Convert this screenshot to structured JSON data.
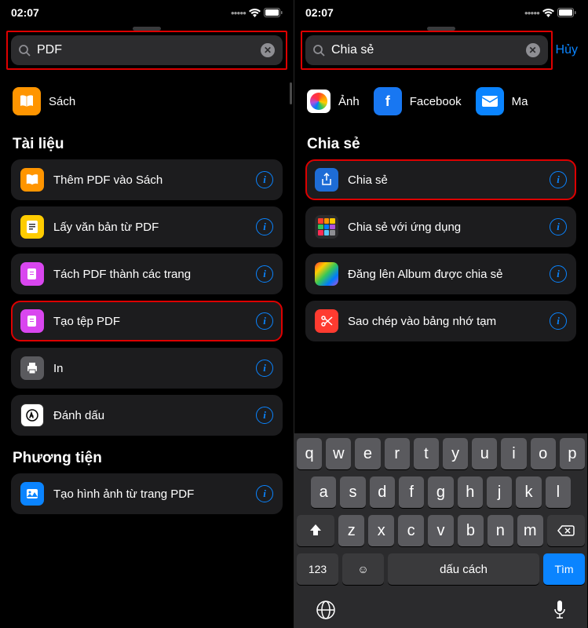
{
  "status": {
    "time": "02:07",
    "wifi": true,
    "battery": true
  },
  "left": {
    "search": {
      "value": "PDF",
      "placeholder": "Tìm kiếm"
    },
    "app_row": [
      {
        "name": "Sách",
        "icon": "book",
        "bg": "bg-orange"
      }
    ],
    "sections": [
      {
        "title": "Tài liệu",
        "items": [
          {
            "label": "Thêm PDF vào Sách",
            "icon": "book",
            "bg": "bg-orange",
            "highlight": false
          },
          {
            "label": "Lấy văn bản từ PDF",
            "icon": "text",
            "bg": "bg-yellow",
            "highlight": false
          },
          {
            "label": "Tách PDF thành các trang",
            "icon": "split",
            "bg": "bg-magenta",
            "highlight": false
          },
          {
            "label": "Tạo tệp PDF",
            "icon": "make",
            "bg": "bg-magenta",
            "highlight": true
          },
          {
            "label": "In",
            "icon": "print",
            "bg": "bg-gray",
            "highlight": false
          },
          {
            "label": "Đánh dấu",
            "icon": "markup",
            "bg": "bg-white",
            "highlight": false
          }
        ]
      },
      {
        "title": "Phương tiện",
        "items": [
          {
            "label": "Tạo hình ảnh từ trang PDF",
            "icon": "image",
            "bg": "bg-blue",
            "highlight": false
          }
        ]
      }
    ]
  },
  "right": {
    "search": {
      "value": "Chia sẻ",
      "placeholder": "Tìm kiếm"
    },
    "cancel": "Hủy",
    "app_row": [
      {
        "name": "Ảnh",
        "icon": "photos"
      },
      {
        "name": "Facebook",
        "icon": "fb"
      },
      {
        "name": "Ma",
        "icon": "mail"
      }
    ],
    "sections": [
      {
        "title": "Chia sẻ",
        "items": [
          {
            "label": "Chia sẻ",
            "icon": "share",
            "bg": "bg-darkblue",
            "highlight": true
          },
          {
            "label": "Chia sẻ với ứng dụng",
            "icon": "grid",
            "bg": "bg-grid",
            "highlight": false
          },
          {
            "label": "Đăng lên Album được chia sẻ",
            "icon": "photos-flower",
            "bg": "bg-multi",
            "highlight": false
          },
          {
            "label": "Sao chép vào bảng nhớ tạm",
            "icon": "scissors",
            "bg": "bg-red",
            "highlight": false
          }
        ]
      }
    ],
    "keyboard": {
      "row1": [
        "q",
        "w",
        "e",
        "r",
        "t",
        "y",
        "u",
        "i",
        "o",
        "p"
      ],
      "row2": [
        "a",
        "s",
        "d",
        "f",
        "g",
        "h",
        "j",
        "k",
        "l"
      ],
      "row3": [
        "z",
        "x",
        "c",
        "v",
        "b",
        "n",
        "m"
      ],
      "num": "123",
      "space": "dấu cách",
      "return": "Tìm"
    }
  }
}
